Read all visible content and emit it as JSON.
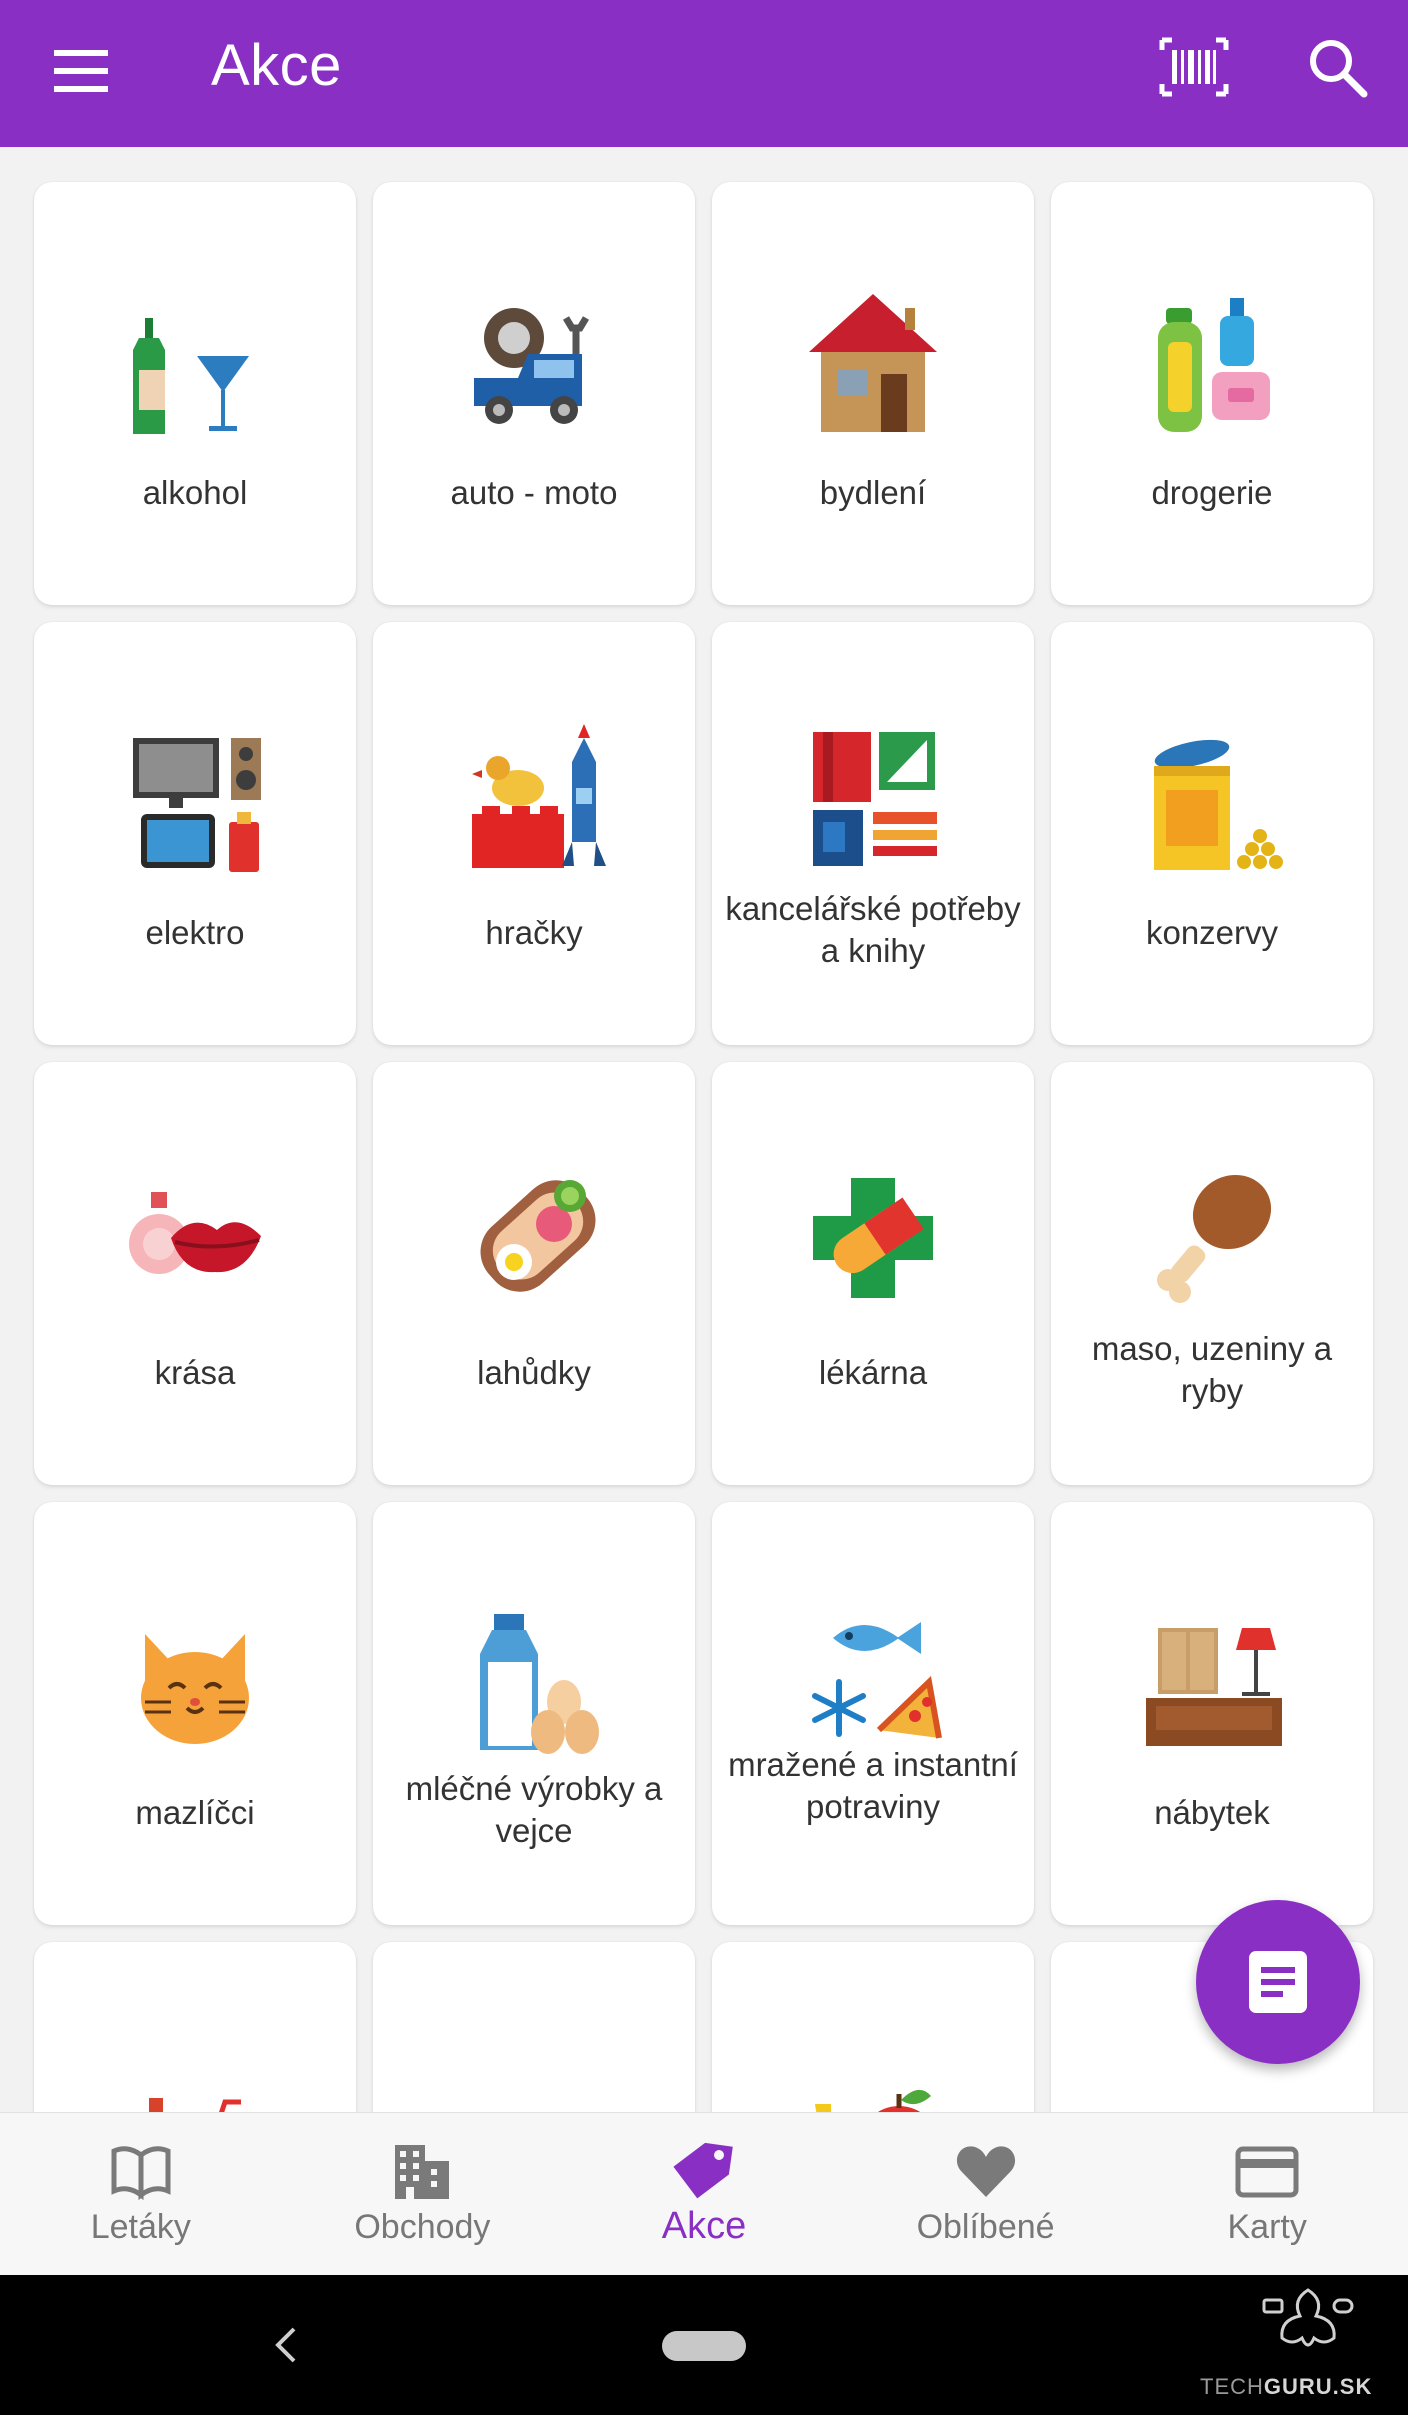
{
  "appbar": {
    "title": "Akce",
    "left_icon": "menu-icon",
    "right_icons": [
      "barcode-icon",
      "search-icon"
    ],
    "color": "#8a2fc4"
  },
  "categories": [
    {
      "label": "alkohol",
      "icon": "alcohol-icon"
    },
    {
      "label": "auto - moto",
      "icon": "car-tools-icon"
    },
    {
      "label": "bydlení",
      "icon": "house-icon"
    },
    {
      "label": "drogerie",
      "icon": "cosmetics-bottles-icon"
    },
    {
      "label": "elektro",
      "icon": "electronics-icon"
    },
    {
      "label": "hračky",
      "icon": "toys-icon"
    },
    {
      "label": "kancelářské potřeby a knihy",
      "icon": "office-books-icon"
    },
    {
      "label": "konzervy",
      "icon": "canned-food-icon"
    },
    {
      "label": "krása",
      "icon": "perfume-lips-icon"
    },
    {
      "label": "lahůdky",
      "icon": "delicatessen-icon"
    },
    {
      "label": "lékárna",
      "icon": "pharmacy-icon"
    },
    {
      "label": "maso, uzeniny a ryby",
      "icon": "drumstick-icon"
    },
    {
      "label": "mazlíčci",
      "icon": "cat-icon"
    },
    {
      "label": "mléčné výrobky a vejce",
      "icon": "milk-eggs-icon"
    },
    {
      "label": "mražené a instantní potraviny",
      "icon": "frozen-food-icon"
    },
    {
      "label": "nábytek",
      "icon": "furniture-icon"
    },
    {
      "label": "",
      "icon": "drinks-icon"
    },
    {
      "label": "",
      "icon": "clothes-icon"
    },
    {
      "label": "",
      "icon": "fruit-icon"
    },
    {
      "label": "",
      "icon": "bakery-icon"
    }
  ],
  "fab": {
    "icon": "list-document-icon"
  },
  "bottom_nav": [
    {
      "label": "Letáky",
      "icon": "open-book-icon",
      "active": false
    },
    {
      "label": "Obchody",
      "icon": "building-icon",
      "active": false
    },
    {
      "label": "Akce",
      "icon": "tag-icon",
      "active": true
    },
    {
      "label": "Oblíbené",
      "icon": "heart-icon",
      "active": false
    },
    {
      "label": "Karty",
      "icon": "card-icon",
      "active": false
    }
  ],
  "watermark": {
    "text_light": "TECH",
    "text_bold": "GURU.SK"
  }
}
